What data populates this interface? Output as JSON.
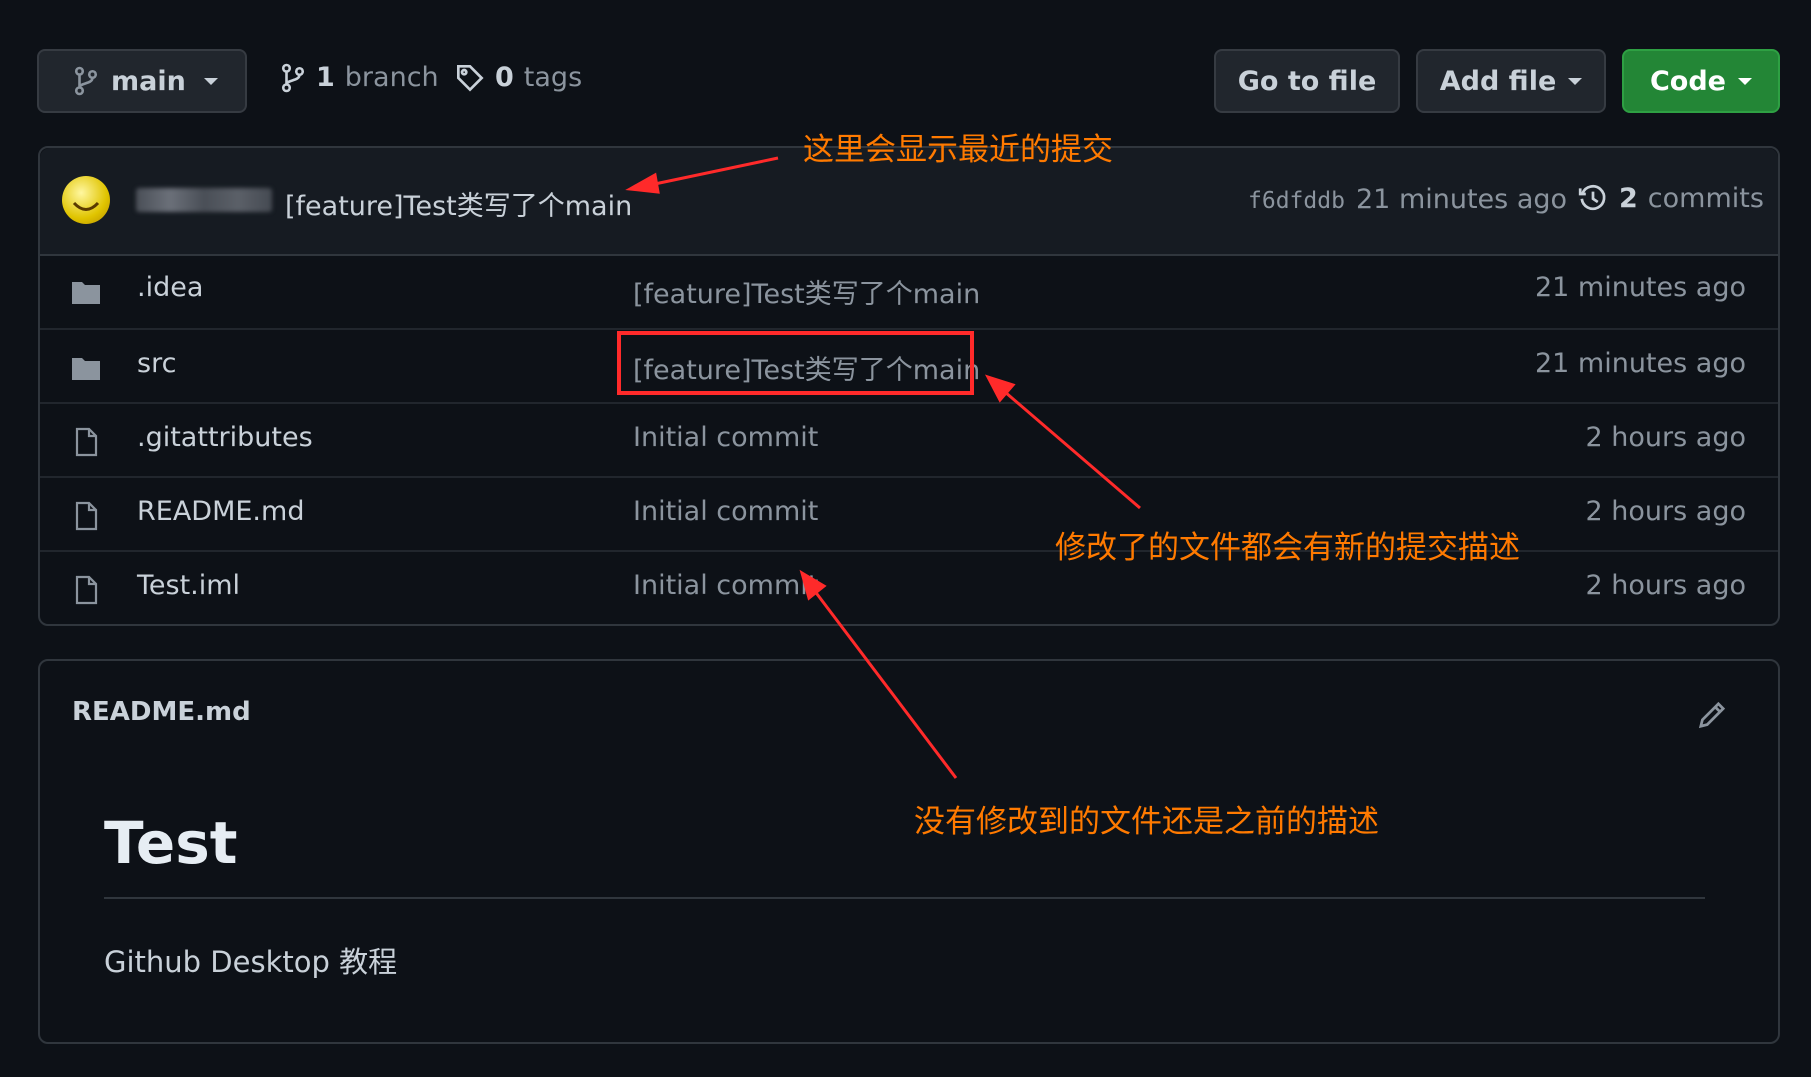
{
  "branch_selector": {
    "label": "main"
  },
  "branches": {
    "count": "1",
    "label": "branch"
  },
  "tags": {
    "count": "0",
    "label": "tags"
  },
  "actions": {
    "go_to_file": "Go to file",
    "add_file": "Add file",
    "code": "Code"
  },
  "latest_commit": {
    "message": "[feature]Test类写了个main",
    "hash": "f6dfddb",
    "time": "21 minutes ago",
    "commits_count": "2",
    "commits_label": "commits"
  },
  "files": [
    {
      "name": ".idea",
      "type": "folder",
      "message": "[feature]Test类写了个main",
      "age": "21 minutes ago"
    },
    {
      "name": "src",
      "type": "folder",
      "message": "[feature]Test类写了个main",
      "age": "21 minutes ago"
    },
    {
      "name": ".gitattributes",
      "type": "file",
      "message": "Initial commit",
      "age": "2 hours ago"
    },
    {
      "name": "README.md",
      "type": "file",
      "message": "Initial commit",
      "age": "2 hours ago"
    },
    {
      "name": "Test.iml",
      "type": "file",
      "message": "Initial commit",
      "age": "2 hours ago"
    }
  ],
  "readme": {
    "filename": "README.md",
    "heading": "Test",
    "body": "Github Desktop 教程"
  },
  "annotations": {
    "latest_commit_note": "这里会显示最近的提交",
    "modified_note": "修改了的文件都会有新的提交描述",
    "unmodified_note": "没有修改到的文件还是之前的描述"
  },
  "colors": {
    "background": "#0d1117",
    "code_button": "#238636",
    "annotation": "#ff7a00",
    "highlight_box": "#ff2a2a"
  }
}
